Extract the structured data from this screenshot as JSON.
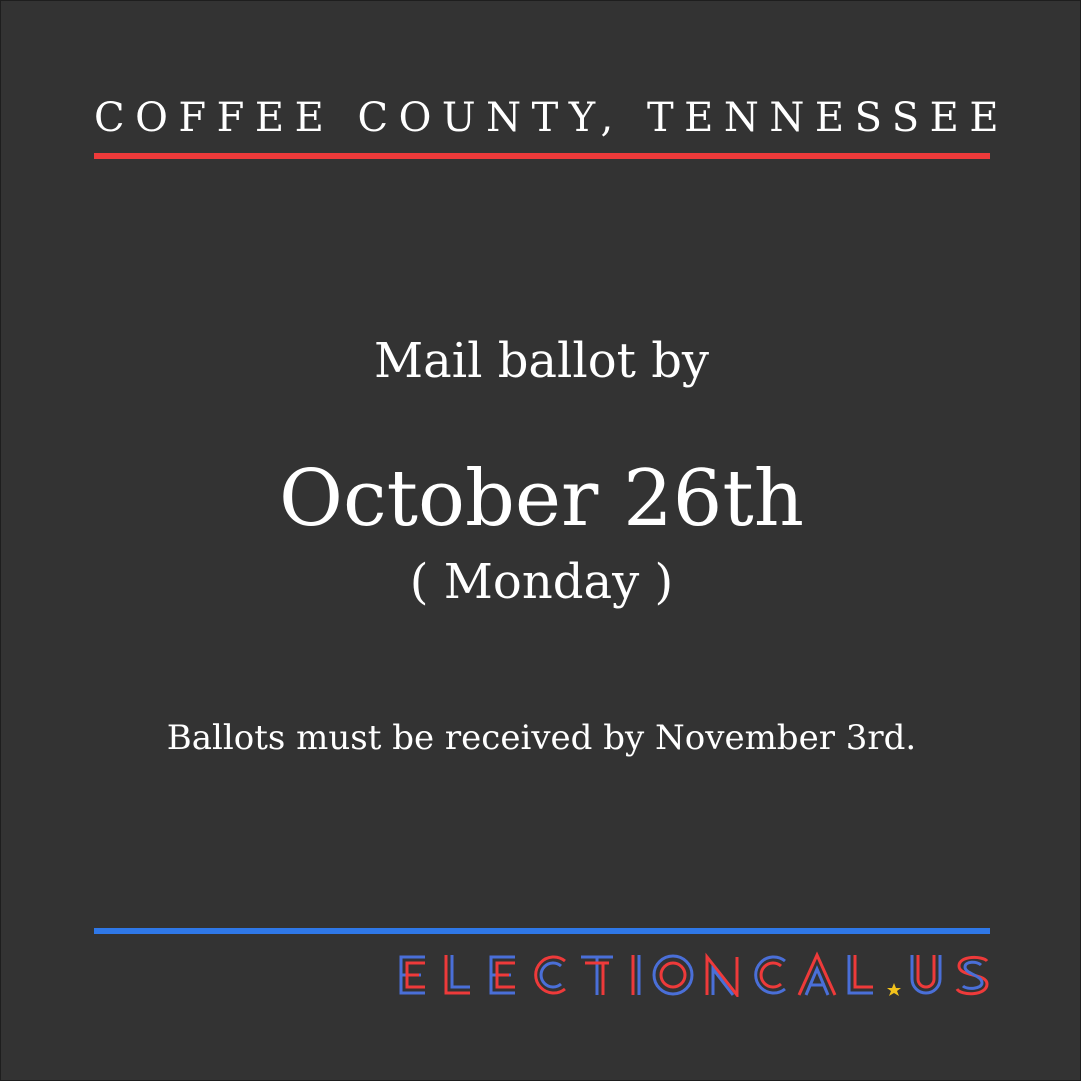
{
  "header": {
    "county": "COFFEE COUNTY, TENNESSEE"
  },
  "main": {
    "mail_label": "Mail ballot by",
    "deadline_date": "October 26th",
    "deadline_weekday": "( Monday )",
    "received_note": "Ballots must be received by November 3rd."
  },
  "footer": {
    "logo_text": "ELECTIONCAL.US"
  },
  "colors": {
    "background": "#333333",
    "accent_red": "#ee3a3a",
    "accent_blue": "#2f78e8",
    "logo_star": "#f2c21b"
  }
}
